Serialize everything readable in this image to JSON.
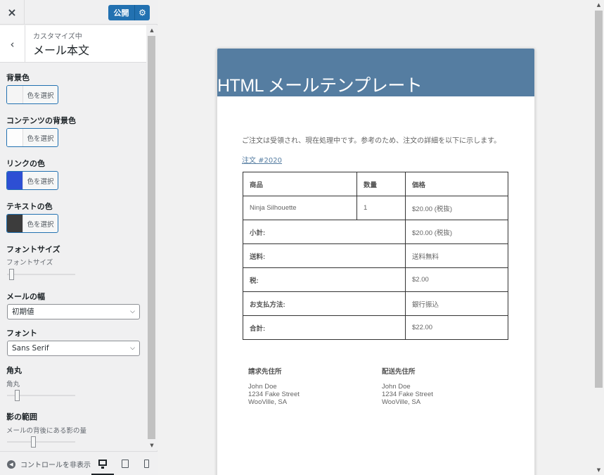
{
  "topbar": {
    "close_icon": "×",
    "publish_label": "公開",
    "publish_settings_icon": "⚙"
  },
  "section": {
    "back_icon": "‹",
    "breadcrumb": "カスタマイズ中",
    "title": "メール本文"
  },
  "controls": {
    "bg_color": {
      "label": "背景色",
      "button": "色を選択",
      "swatch": "#f5f5f5"
    },
    "content_bg_color": {
      "label": "コンテンツの背景色",
      "button": "色を選択",
      "swatch": "#fdfdfd"
    },
    "link_color": {
      "label": "リンクの色",
      "button": "色を選択",
      "swatch": "#2d4fd4"
    },
    "text_color": {
      "label": "テキストの色",
      "button": "色を選択",
      "swatch": "#3c3c3c"
    },
    "font_size": {
      "label": "フォントサイズ",
      "sublabel": "フォントサイズ",
      "level": 0.03
    },
    "email_width": {
      "label": "メールの幅",
      "value": "初期値"
    },
    "font": {
      "label": "フォント",
      "value": "Sans Serif"
    },
    "rounded": {
      "label": "角丸",
      "sublabel": "角丸",
      "level": 0.12
    },
    "shadow": {
      "label": "影の範囲",
      "sublabel": "メールの背後にある影の量",
      "level": 0.38
    }
  },
  "footer": {
    "hide_controls": "コントロールを非表示",
    "devices": [
      "desktop-icon",
      "tablet-icon",
      "mobile-icon"
    ]
  },
  "email": {
    "header_color": "#557da1",
    "title": "HTML メールテンプレート",
    "intro": "ご注文は受領され、現在処理中です。参考のため、注文の詳細を以下に示します。",
    "order_link": "注文 #2020",
    "table": {
      "headers": [
        "商品",
        "数量",
        "価格"
      ],
      "item": {
        "name": "Ninja Silhouette",
        "qty": "1",
        "price": "$20.00 (税抜)"
      },
      "totals": [
        {
          "label": "小計:",
          "value": "$20.00 (税抜)"
        },
        {
          "label": "送料:",
          "value": "送料無料"
        },
        {
          "label": "税:",
          "value": "$2.00"
        },
        {
          "label": "お支払方法:",
          "value": "銀行振込"
        },
        {
          "label": "合計:",
          "value": "$22.00"
        }
      ]
    },
    "billing": {
      "title": "請求先住所",
      "lines": [
        "John Doe",
        "1234 Fake Street",
        "WooVille, SA"
      ]
    },
    "shipping": {
      "title": "配送先住所",
      "lines": [
        "John Doe",
        "1234 Fake Street",
        "WooVille, SA"
      ]
    }
  }
}
